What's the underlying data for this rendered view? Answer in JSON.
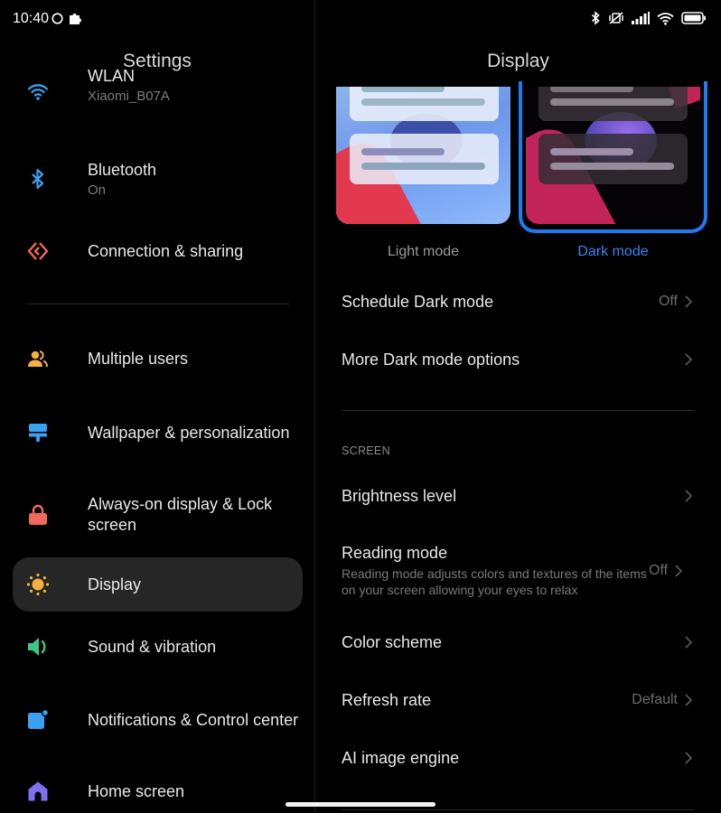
{
  "status_bar": {
    "time": "10:40",
    "left_icons": [
      "circle-icon",
      "puzzle-icon"
    ],
    "right_icons": [
      "bluetooth-icon",
      "vibrate-off-icon",
      "signal-icon",
      "wifi-icon",
      "battery-icon"
    ]
  },
  "left_pane": {
    "title": "Settings",
    "items": [
      {
        "label": "WLAN",
        "sub": "Xiaomi_B07A",
        "icon": "wifi-icon",
        "color": "#3aa0f0"
      },
      {
        "label": "Bluetooth",
        "sub": "On",
        "icon": "bluetooth-icon",
        "color": "#3aa0f0"
      },
      {
        "label": "Connection & sharing",
        "icon": "connection-sharing-icon",
        "color": "#ef6a5a"
      },
      {
        "label": "Multiple users",
        "icon": "users-icon",
        "color": "#f5b13d"
      },
      {
        "label": "Wallpaper & personalization",
        "icon": "wallpaper-icon",
        "color": "#3aa0f0"
      },
      {
        "label": "Always-on display & Lock screen",
        "icon": "lock-icon",
        "color": "#ef6a5a"
      },
      {
        "label": "Display",
        "icon": "sun-icon",
        "color": "#f5b13d",
        "active": true
      },
      {
        "label": "Sound & vibration",
        "icon": "speaker-icon",
        "color": "#3ec784"
      },
      {
        "label": "Notifications & Control center",
        "icon": "notification-icon",
        "color": "#3aa0f0"
      },
      {
        "label": "Home screen",
        "icon": "home-icon",
        "color": "#7c72f0"
      }
    ]
  },
  "right_pane": {
    "title": "Display",
    "modes": {
      "light_label": "Light mode",
      "dark_label": "Dark mode",
      "selected": "Dark mode",
      "accent": "#1e7cf2"
    },
    "rows_top": [
      {
        "title": "Schedule Dark mode",
        "value": "Off"
      },
      {
        "title": "More Dark mode options",
        "value": ""
      }
    ],
    "section_header": "SCREEN",
    "rows_screen": [
      {
        "title": "Brightness level",
        "value": ""
      },
      {
        "title": "Reading mode",
        "desc": "Reading mode adjusts colors and textures of the items on your screen allowing your eyes to relax",
        "value": "Off"
      },
      {
        "title": "Color scheme",
        "value": ""
      },
      {
        "title": "Refresh rate",
        "value": "Default"
      },
      {
        "title": "AI image engine",
        "value": ""
      }
    ]
  }
}
